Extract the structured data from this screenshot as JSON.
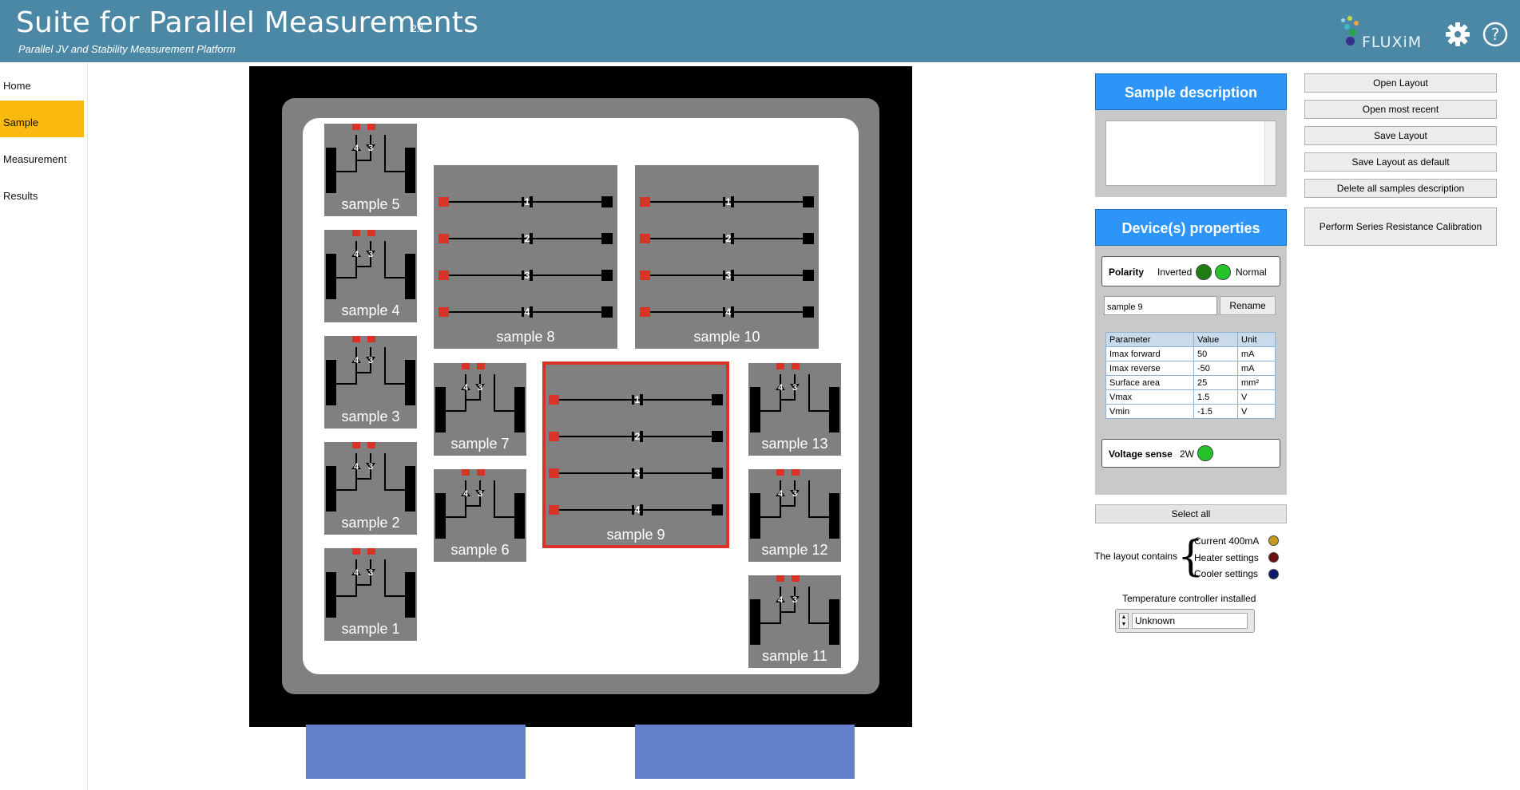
{
  "header": {
    "title": "Suite for Parallel Measurements",
    "version": "2.1",
    "subtitle": "Parallel JV and Stability Measurement Platform",
    "logo_text": "FLUXiM",
    "icons": [
      "gear-icon",
      "help-icon"
    ]
  },
  "sidebar": {
    "items": [
      {
        "label": "Home",
        "active": false
      },
      {
        "label": "Sample",
        "active": true
      },
      {
        "label": "Measurement",
        "active": false
      },
      {
        "label": "Results",
        "active": false
      }
    ]
  },
  "layout": {
    "samples": [
      {
        "label": "sample 5",
        "kind": "small",
        "pixels": [
          "4",
          "3"
        ]
      },
      {
        "label": "sample 4",
        "kind": "small",
        "pixels": [
          "4",
          "3"
        ]
      },
      {
        "label": "sample 3",
        "kind": "small",
        "pixels": [
          "4",
          "3"
        ]
      },
      {
        "label": "sample 2",
        "kind": "small",
        "pixels": [
          "4",
          "3"
        ]
      },
      {
        "label": "sample 1",
        "kind": "small",
        "pixels": [
          "4",
          "3"
        ]
      },
      {
        "label": "sample 8",
        "kind": "large",
        "pixels": [
          "1",
          "2",
          "3",
          "4"
        ]
      },
      {
        "label": "sample 10",
        "kind": "large",
        "pixels": [
          "1",
          "2",
          "3",
          "4"
        ]
      },
      {
        "label": "sample 7",
        "kind": "small",
        "pixels": [
          "4",
          "3"
        ]
      },
      {
        "label": "sample 6",
        "kind": "small",
        "pixels": [
          "4",
          "3"
        ]
      },
      {
        "label": "sample 9",
        "kind": "large",
        "pixels": [
          "1",
          "2",
          "3",
          "4"
        ],
        "selected": true
      },
      {
        "label": "sample 13",
        "kind": "small",
        "pixels": [
          "4",
          "3"
        ]
      },
      {
        "label": "sample 12",
        "kind": "small",
        "pixels": [
          "4",
          "3"
        ]
      },
      {
        "label": "sample 11",
        "kind": "small",
        "pixels": [
          "4",
          "3"
        ]
      }
    ]
  },
  "sample_description": {
    "title": "Sample description",
    "text": ""
  },
  "device_properties": {
    "title": "Device(s) properties",
    "polarity_label": "Polarity",
    "inverted_label": "Inverted",
    "normal_label": "Normal",
    "name_value": "sample 9",
    "rename_label": "Rename",
    "table_headers": [
      "Parameter",
      "Value",
      "Unit"
    ],
    "rows": [
      [
        "Imax forward",
        "50",
        "mA"
      ],
      [
        "Imax reverse",
        "-50",
        "mA"
      ],
      [
        "Surface area",
        "25",
        "mm²"
      ],
      [
        "Vmax",
        "1.5",
        "V"
      ],
      [
        "Vmin",
        "-1.5",
        "V"
      ]
    ],
    "voltage_sense_label": "Voltage sense",
    "voltage_sense_value": "2W"
  },
  "select_all_label": "Select all",
  "layout_contains": {
    "label": "The layout contains",
    "items": [
      {
        "label": "Current 400mA",
        "color": "#c79a1e"
      },
      {
        "label": "Heater settings",
        "color": "#6b0f0f"
      },
      {
        "label": "Cooler settings",
        "color": "#0b1a6e"
      }
    ]
  },
  "temperature": {
    "label": "Temperature controller installed",
    "value": "Unknown"
  },
  "buttons": [
    "Open Layout",
    "Open most recent",
    "Save Layout",
    "Save Layout as default",
    "Delete all samples description"
  ],
  "calibration_button": "Perform Series Resistance Calibration",
  "colors": {
    "header": "#4b88a6",
    "active_nav": "#fbb80f",
    "panel_head": "#2d95f7",
    "contact_red": "#d93226",
    "connector": "#6580cc",
    "led_green": "#23c52a"
  }
}
